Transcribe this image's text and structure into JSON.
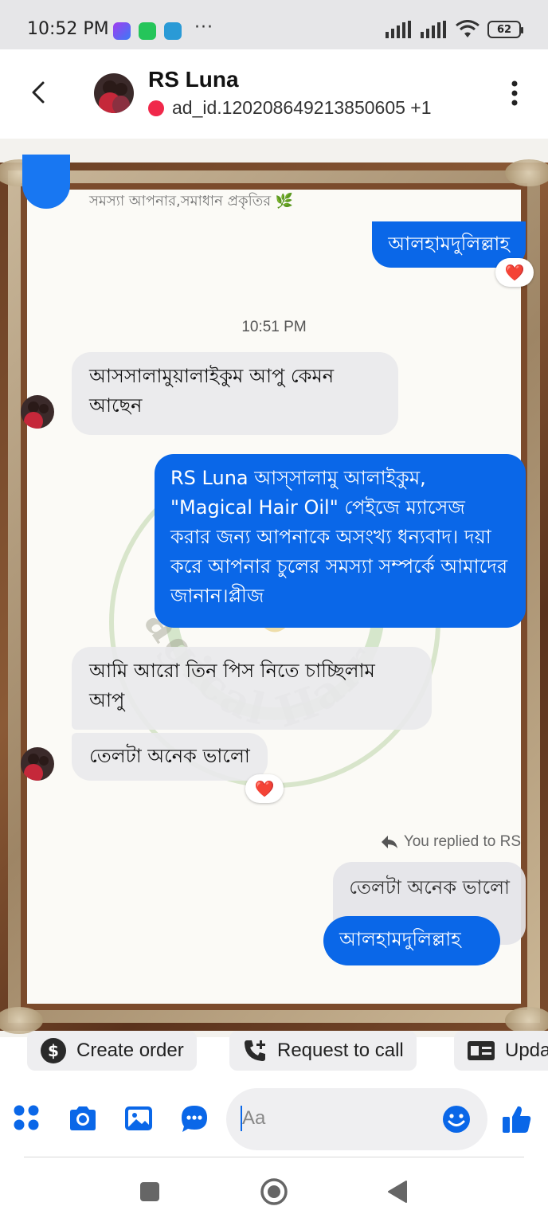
{
  "status_bar": {
    "time": "10:52 PM",
    "more": "···",
    "battery": "62"
  },
  "header": {
    "name": "RS Luna",
    "subtitle": "ad_id.120208649213850605 +1"
  },
  "chat": {
    "top_hint": "সমস্যা আপনার,সমাধান প্রকৃতির 🌿",
    "messages": [
      {
        "id": "m1",
        "side": "out",
        "text": "আলহামদুলিল্লাহ",
        "reaction": "❤️"
      },
      {
        "id": "t1",
        "type": "time",
        "text": "10:51 PM"
      },
      {
        "id": "m2",
        "side": "in",
        "text": "আসসালামুয়ালাইকুম আপু কেমন আছেন"
      },
      {
        "id": "m3",
        "side": "out",
        "text": "RS Luna আস্সালামু আলাইকুম, \"Magical Hair Oil\" পেইজে ম্যাসেজ করার জন্য আপনাকে অসংখ্য ধন্যবাদ। দয়া করে আপনার চুলের সমস্যা সম্পর্কে আমাদের জানান।প্লীজ"
      },
      {
        "id": "m4",
        "side": "in",
        "text": "আমি আরো তিন পিস নিতে চাচ্ছিলাম আপু"
      },
      {
        "id": "m5",
        "side": "in",
        "text": "তেলটা অনেক ভালো",
        "reaction": "❤️"
      },
      {
        "id": "r1",
        "type": "reply_label",
        "text": "You replied to RS"
      },
      {
        "id": "m6",
        "side": "quote",
        "text": "তেলটা অনেক ভালো"
      },
      {
        "id": "m7",
        "side": "out",
        "text": "আলহামদুলিল্লাহ"
      }
    ],
    "watermark_text": "Magical Hair Oil"
  },
  "quick_actions": [
    {
      "label": "Create order",
      "icon": "dollar-icon"
    },
    {
      "label": "Request to call",
      "icon": "phone-plus-icon"
    },
    {
      "label": "Upda",
      "icon": "id-card-icon"
    }
  ],
  "composer": {
    "placeholder": "Aa"
  },
  "colors": {
    "accent": "#0a67e8",
    "bubble_in": "#e9e9ec",
    "frame": "#7b4b2c",
    "status_dot": "#f0284a"
  }
}
